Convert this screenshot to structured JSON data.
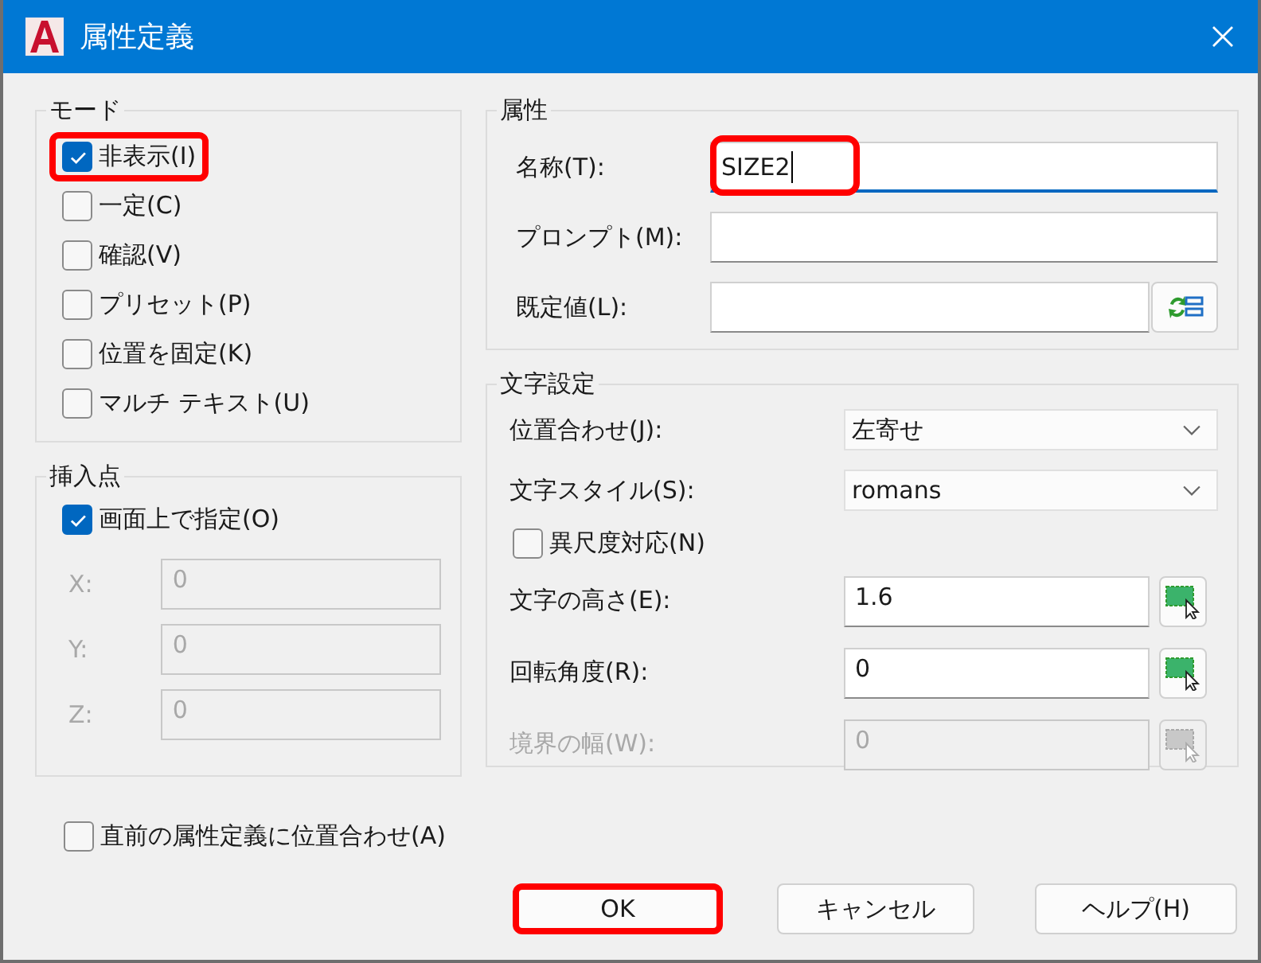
{
  "window": {
    "title": "属性定義"
  },
  "mode": {
    "title": "モード",
    "options": [
      {
        "label": "非表示(I)",
        "checked": true,
        "highlighted": true
      },
      {
        "label": "一定(C)",
        "checked": false,
        "highlighted": false
      },
      {
        "label": "確認(V)",
        "checked": false,
        "highlighted": false
      },
      {
        "label": "プリセット(P)",
        "checked": false,
        "highlighted": false
      },
      {
        "label": "位置を固定(K)",
        "checked": false,
        "highlighted": false
      },
      {
        "label": "マルチ テキスト(U)",
        "checked": false,
        "highlighted": false
      }
    ]
  },
  "insertion_point": {
    "title": "挿入点",
    "on_screen": {
      "label": "画面上で指定(O)",
      "checked": true
    },
    "coords": [
      {
        "label": "X:",
        "value": "0",
        "disabled": true
      },
      {
        "label": "Y:",
        "value": "0",
        "disabled": true
      },
      {
        "label": "Z:",
        "value": "0",
        "disabled": true
      }
    ]
  },
  "attribute": {
    "title": "属性",
    "fields": [
      {
        "kind": "text",
        "label": "名称(T):",
        "value": "SIZE2",
        "focused": true,
        "highlighted": true
      },
      {
        "kind": "text",
        "label": "プロンプト(M):",
        "focused": false
      },
      {
        "kind": "field_button",
        "label": "既定値(L):",
        "focused": false
      }
    ]
  },
  "text_settings": {
    "title": "文字設定",
    "rows": [
      {
        "kind": "select",
        "label": "位置合わせ(J):",
        "value": "左寄せ"
      },
      {
        "kind": "select",
        "label": "文字スタイル(S):",
        "value": "romans"
      },
      {
        "kind": "checkbox",
        "label": "異尺度対応(N)",
        "checked": false
      },
      {
        "kind": "pick",
        "label": "文字の高さ(E):",
        "value": "1.6",
        "disabled": false
      },
      {
        "kind": "pick",
        "label": "回転角度(R):",
        "value": "0",
        "disabled": false
      },
      {
        "kind": "pick",
        "label": "境界の幅(W):",
        "value": "0",
        "disabled": true
      }
    ]
  },
  "align_previous": {
    "label": "直前の属性定義に位置合わせ(A)",
    "checked": false
  },
  "buttons": [
    {
      "label": "OK",
      "highlighted": true
    },
    {
      "label": "キャンセル",
      "highlighted": false
    },
    {
      "label": "ヘルプ(H)",
      "highlighted": false
    }
  ]
}
